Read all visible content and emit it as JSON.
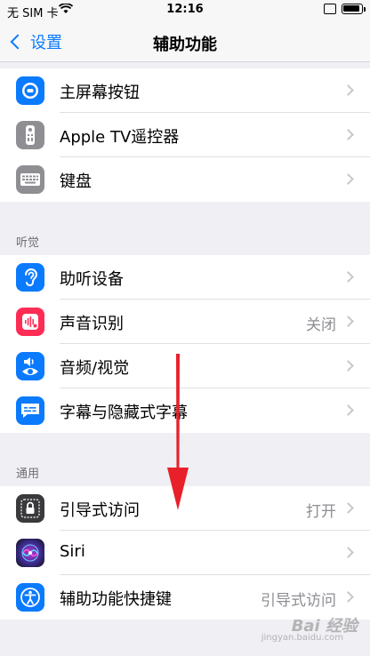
{
  "status_bar": {
    "carrier": "无 SIM 卡",
    "time": "12:16"
  },
  "nav": {
    "back_label": "设置",
    "title": "辅助功能"
  },
  "groups": {
    "top": [
      {
        "label": "主屏幕按钮",
        "icon": "home-button-icon"
      },
      {
        "label": "Apple TV遥控器",
        "icon": "tv-remote-icon"
      },
      {
        "label": "键盘",
        "icon": "keyboard-icon"
      }
    ],
    "hearing": {
      "header": "听觉",
      "items": [
        {
          "label": "助听设备",
          "icon": "ear-icon"
        },
        {
          "label": "声音识别",
          "value": "关闭",
          "icon": "sound-recognition-icon"
        },
        {
          "label": "音频/视觉",
          "icon": "audio-visual-icon"
        },
        {
          "label": "字幕与隐藏式字幕",
          "icon": "subtitles-icon"
        }
      ]
    },
    "general": {
      "header": "通用",
      "items": [
        {
          "label": "引导式访问",
          "value": "打开",
          "icon": "lock-icon"
        },
        {
          "label": "Siri",
          "icon": "siri-icon"
        },
        {
          "label": "辅助功能快捷键",
          "value": "引导式访问",
          "icon": "accessibility-icon"
        }
      ]
    }
  },
  "watermark": {
    "text": "Bai 经验",
    "sub": "jingyan.baidu.com"
  },
  "colors": {
    "accent": "#0a7aff",
    "red_arrow": "#e8202a"
  }
}
